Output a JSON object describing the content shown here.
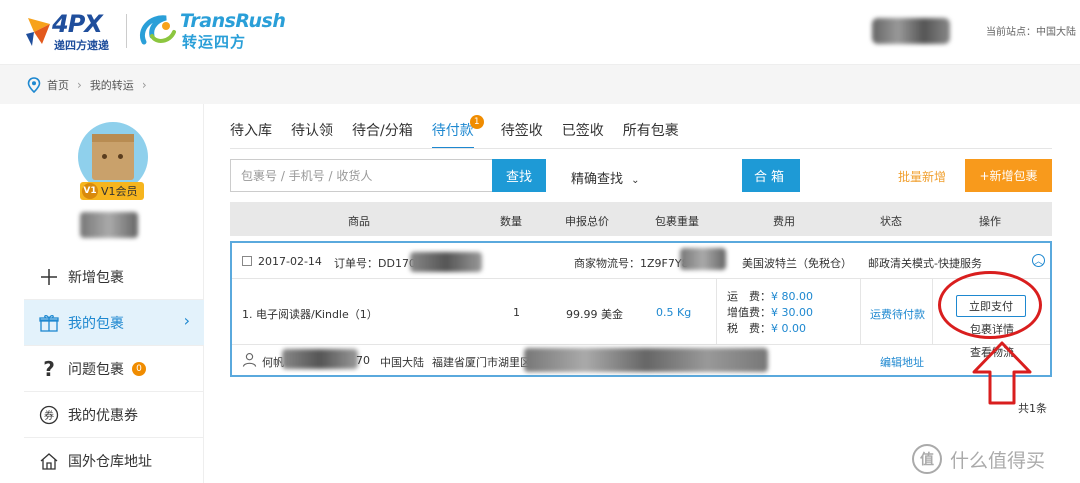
{
  "header": {
    "logo_4px": {
      "main": "4PX",
      "sub": "递四方速递"
    },
    "logo_transrush": {
      "main": "TransRush",
      "sub": "转运四方"
    },
    "site_label": "当前站点：中国大陆"
  },
  "breadcrumb": {
    "home": "首页",
    "current": "我的转运"
  },
  "sidebar": {
    "member_badge": {
      "level": "V1",
      "label": "V1会员"
    },
    "items": [
      {
        "label": "新增包裹",
        "icon": "plus-icon"
      },
      {
        "label": "我的包裹",
        "icon": "gift-icon",
        "active": true
      },
      {
        "label": "问题包裹",
        "icon": "question-icon",
        "count": "0"
      },
      {
        "label": "我的优惠券",
        "icon": "coupon-icon"
      },
      {
        "label": "国外仓库地址",
        "icon": "home-icon"
      }
    ]
  },
  "tabs": [
    {
      "label": "待入库"
    },
    {
      "label": "待认领"
    },
    {
      "label": "待合/分箱"
    },
    {
      "label": "待付款",
      "active": true,
      "count": "1"
    },
    {
      "label": "待签收"
    },
    {
      "label": "已签收"
    },
    {
      "label": "所有包裹"
    }
  ],
  "toolbar": {
    "search_placeholder": "包裹号 / 手机号 / 收货人",
    "search_button": "查找",
    "exact_search": "精确查找",
    "merge_button": "合箱",
    "batch_add": "批量新增",
    "add_package": "+新增包裹"
  },
  "table": {
    "headers": [
      "商品",
      "数量",
      "申报总价",
      "包裹重量",
      "费用",
      "状态",
      "操作"
    ]
  },
  "order": {
    "date": "2017-02-14",
    "order_no_label": "订单号：DD170",
    "tracking_label": "商家物流号：1Z9F7Y8",
    "warehouse": "美国波特兰（免税仓）",
    "service": "邮政清关模式-快捷服务",
    "item": "1. 电子阅读器/Kindle（1）",
    "quantity": "1",
    "declared": "99.99 美金",
    "weight": "0.5 Kg",
    "fees": [
      {
        "label": "运　费：",
        "amount": "¥ 80.00"
      },
      {
        "label": "增值费：",
        "amount": "¥ 30.00"
      },
      {
        "label": "税　费：",
        "amount": "¥ 0.00"
      }
    ],
    "status": "运费待付款",
    "pay_button": "立即支付",
    "detail_link": "包裹详情",
    "track_link": "查看物流",
    "recipient_prefix": "何帆",
    "recipient_suffix": "70",
    "country": "中国大陆",
    "address": "福建省厦门市湖里区",
    "edit_address": "编辑地址"
  },
  "total": "共1条",
  "watermark": {
    "icon_text": "值",
    "text": "什么值得买"
  },
  "colors": {
    "accent": "#1e9ad6",
    "orange": "#f89a1c",
    "annotation_red": "#d91e1e"
  }
}
